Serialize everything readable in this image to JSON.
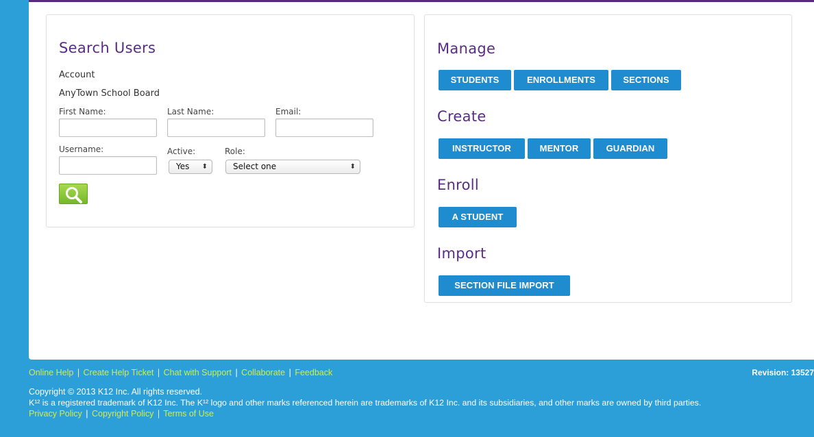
{
  "search": {
    "title": "Search Users",
    "account_label": "Account",
    "account_value": "AnyTown School Board",
    "first_name_label": "First Name:",
    "last_name_label": "Last Name:",
    "email_label": "Email:",
    "username_label": "Username:",
    "active_label": "Active:",
    "active_value": "Yes",
    "role_label": "Role:",
    "role_value": "Select one",
    "first_name_value": "",
    "last_name_value": "",
    "email_value": "",
    "username_value": "",
    "search_icon": "magnifier-icon"
  },
  "manage": {
    "title": "Manage",
    "buttons": [
      "STUDENTS",
      "ENROLLMENTS",
      "SECTIONS"
    ]
  },
  "create": {
    "title": "Create",
    "buttons": [
      "INSTRUCTOR",
      "MENTOR",
      "GUARDIAN"
    ]
  },
  "enroll": {
    "title": "Enroll",
    "buttons": [
      "A STUDENT"
    ]
  },
  "import": {
    "title": "Import",
    "buttons": [
      "SECTION FILE IMPORT"
    ]
  },
  "footer": {
    "links": [
      "Online Help",
      "Create Help Ticket",
      "Chat with Support",
      "Collaborate",
      "Feedback"
    ],
    "separator": "|",
    "revision": "Revision: 13527",
    "copyright": "Copyright © 2013 K12 Inc. All rights reserved.",
    "trademark": "K¹² is a registered trademark of K12 Inc. The K¹² logo and other marks referenced herein are trademarks of K12 Inc. and its subsidiaries, and other marks are owned by third parties.",
    "policy_links": [
      "Privacy Policy",
      "Copyright Policy",
      "Terms of Use"
    ]
  },
  "colors": {
    "background": "#2c9fd8",
    "title_purple": "#5a2c86",
    "button_blue": "#1f8ccf",
    "footer_link": "#d6ee37",
    "search_green": "#8cc63f"
  }
}
